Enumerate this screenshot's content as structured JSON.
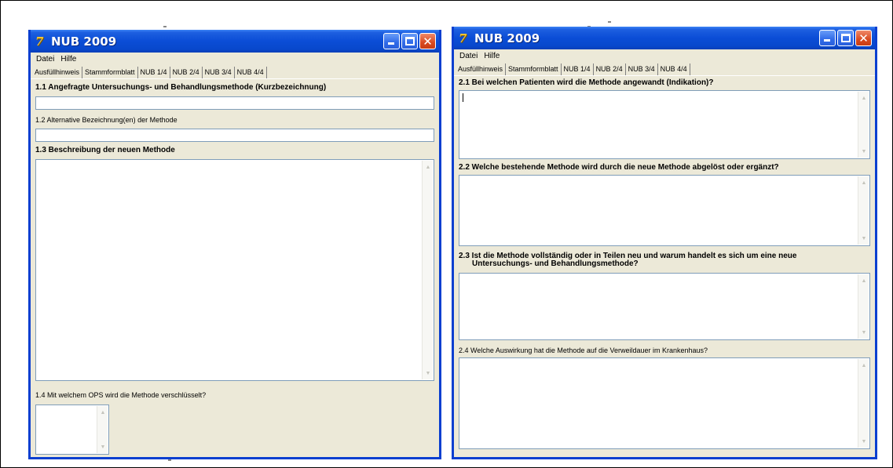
{
  "left_window": {
    "title": "NUB 2009",
    "logo_glyph": "7",
    "menu": [
      "Datei",
      "Hilfe"
    ],
    "tabs": [
      "Ausfüllhinweis",
      "Stammformblatt",
      "NUB 1/4",
      "NUB 2/4",
      "NUB 3/4",
      "NUB 4/4"
    ],
    "active_tab": "NUB 1/4",
    "sections": {
      "s1_1": "1.1 Angefragte Untersuchungs- und Behandlungsmethode (Kurzbezeichnung)",
      "s1_2": "1.2 Alternative Bezeichnung(en) der Methode",
      "s1_3": "1.3 Beschreibung der neuen Methode",
      "s1_4": "1.4 Mit welchem OPS wird die Methode verschlüsselt?"
    }
  },
  "right_window": {
    "title": "NUB 2009",
    "logo_glyph": "7",
    "menu": [
      "Datei",
      "Hilfe"
    ],
    "tabs": [
      "Ausfüllhinweis",
      "Stammformblatt",
      "NUB 1/4",
      "NUB 2/4",
      "NUB 3/4",
      "NUB 4/4"
    ],
    "active_tab": "NUB 2/4",
    "sections": {
      "s2_1": "2.1 Bei welchen Patienten wird die Methode angewandt (Indikation)?",
      "s2_2": "2.2 Welche bestehende Methode wird durch die neue Methode abgelöst oder ergänzt?",
      "s2_3_line1": "2.3 Ist die Methode vollständig oder in Teilen neu und warum handelt es sich um eine neue",
      "s2_3_line2": "Untersuchungs- und Behandlungsmethode?",
      "s2_4": "2.4 Welche Auswirkung hat die Methode auf die Verweildauer im Krankenhaus?"
    }
  },
  "icons": {
    "app_logo": "app-logo-icon",
    "minimize": "minimize-icon",
    "maximize": "maximize-icon",
    "close": "close-icon",
    "scroll_up": "scroll-up-arrow-icon",
    "scroll_down": "scroll-down-arrow-icon"
  },
  "colors": {
    "titlebar": "#0b4dd6",
    "window_face": "#ece9d8",
    "close_button": "#d84a20",
    "textbox_border": "#7f9db9"
  }
}
